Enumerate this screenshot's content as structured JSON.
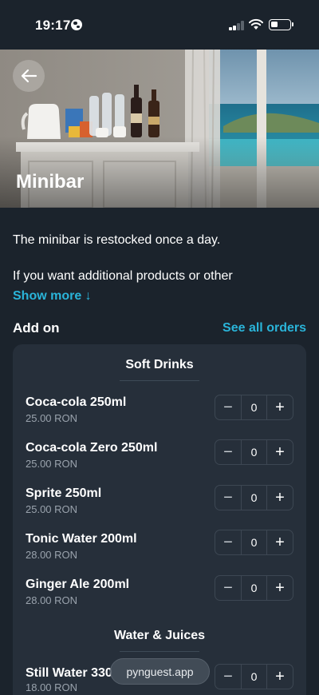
{
  "status_bar": {
    "time": "19:17",
    "icons": [
      "globe-icon",
      "cellular-signal-icon",
      "wifi-icon",
      "battery-icon"
    ]
  },
  "header": {
    "title": "Minibar",
    "back_icon": "arrow-left-icon"
  },
  "intro": {
    "line1": "The minibar is restocked once a day.",
    "line2": "If you want additional products or other",
    "show_more": "Show more ↓"
  },
  "addon": {
    "title": "Add on",
    "see_all": "See all orders",
    "categories": [
      {
        "name": "Soft Drinks",
        "items": [
          {
            "name": "Coca-cola 250ml",
            "price": "25.00 RON",
            "qty": "0"
          },
          {
            "name": "Coca-cola Zero 250ml",
            "price": "25.00 RON",
            "qty": "0"
          },
          {
            "name": "Sprite 250ml",
            "price": "25.00 RON",
            "qty": "0"
          },
          {
            "name": "Tonic Water 200ml",
            "price": "28.00 RON",
            "qty": "0"
          },
          {
            "name": "Ginger Ale 200ml",
            "price": "28.00 RON",
            "qty": "0"
          }
        ]
      },
      {
        "name": "Water & Juices",
        "items": [
          {
            "name": "Still Water 330",
            "price": "18.00 RON",
            "qty": "0"
          }
        ]
      }
    ],
    "stepper": {
      "minus": "−",
      "plus": "+"
    }
  },
  "url_bar": {
    "text": "pynguest.app"
  },
  "colors": {
    "background": "#1b232c",
    "card": "#262f3a",
    "accent": "#2ab4d9",
    "muted_text": "#9aa3ad"
  }
}
